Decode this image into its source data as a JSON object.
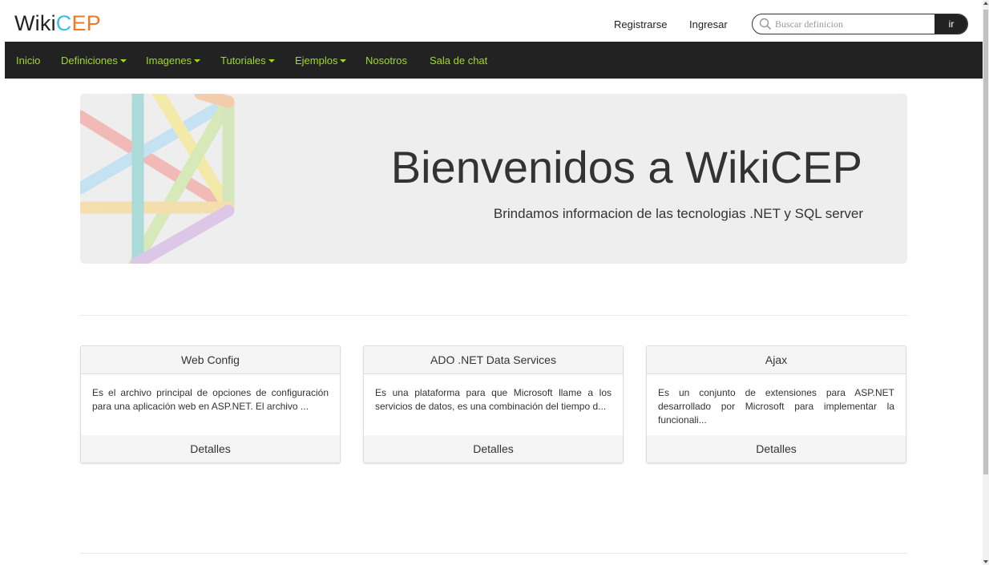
{
  "header": {
    "logo": {
      "part1": "Wiki",
      "part2": "C",
      "part3": "EP"
    },
    "register_label": "Registrarse",
    "login_label": "Ingresar",
    "search": {
      "placeholder": "Buscar definicion",
      "value": "",
      "button_label": "ir"
    }
  },
  "nav": {
    "items": [
      {
        "label": "Inicio",
        "dropdown": false
      },
      {
        "label": "Definiciones",
        "dropdown": true
      },
      {
        "label": "Imagenes",
        "dropdown": true
      },
      {
        "label": "Tutoriales",
        "dropdown": true
      },
      {
        "label": "Ejemplos",
        "dropdown": true
      },
      {
        "label": "Nosotros",
        "dropdown": false
      },
      {
        "label": "Sala de chat",
        "dropdown": false
      }
    ]
  },
  "hero": {
    "title": "Bienvenidos a WikiCEP",
    "subtitle": "Brindamos informacion de las tecnologias .NET y SQL server"
  },
  "cards": [
    {
      "title": "Web Config",
      "body": "Es el archivo principal de opciones de configuración para una aplicación web en ASP.NET. El archivo ...",
      "footer": "Detalles"
    },
    {
      "title": "ADO .NET Data Services",
      "body": "Es una plataforma para que Microsoft llame a los servicios de datos, es una combinación del tiempo d...",
      "footer": "Detalles"
    },
    {
      "title": "Ajax",
      "body": "Es un conjunto de extensiones para ASP.NET desarrollado por Microsoft para implementar la funcionali...",
      "footer": "Detalles"
    }
  ],
  "colors": {
    "navbar_bg": "#222222",
    "nav_text": "#9fdc1e",
    "logo_c": "#3cbeea",
    "logo_ep": "#f07a22",
    "jumbotron_bg": "#eeeeee"
  }
}
